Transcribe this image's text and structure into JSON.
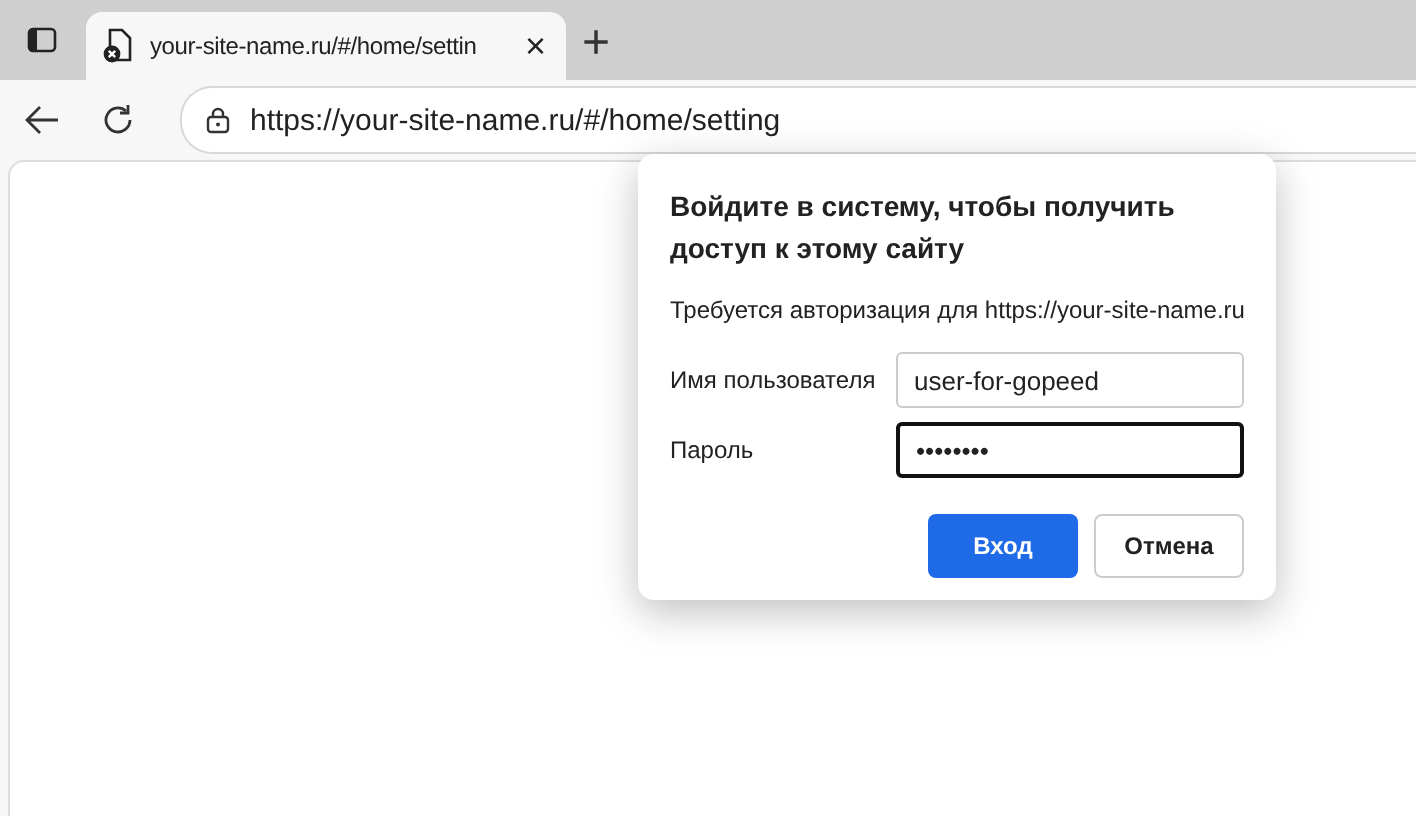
{
  "tab": {
    "title": "your-site-name.ru/#/home/settin",
    "close": "×",
    "new_tab": "+"
  },
  "address_bar": {
    "url": "https://your-site-name.ru/#/home/setting"
  },
  "dialog": {
    "title": "Войдите в систему, чтобы получить доступ к этому сайту",
    "message": "Требуется авторизация для https://your-site-name.ru",
    "fields": [
      {
        "label": "Имя пользователя",
        "value": "user-for-gopeed",
        "focused": false
      },
      {
        "label": "Пароль",
        "value": "••••••••",
        "focused": true
      }
    ],
    "buttons": [
      {
        "label": "Вход",
        "kind": "primary"
      },
      {
        "label": "Отмена",
        "kind": "secondary"
      }
    ]
  }
}
